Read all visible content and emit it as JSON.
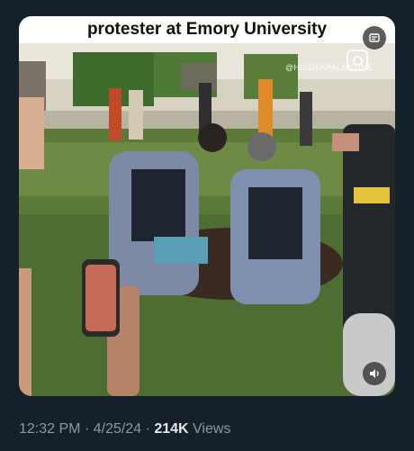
{
  "video": {
    "caption": "protester at Emory University",
    "watermark": "@HIDDENPALESTINE"
  },
  "icons": {
    "alt_overlay": "media-overlay-icon",
    "instagram": "instagram-icon",
    "mute": "speaker-icon"
  },
  "tweet_meta": {
    "time": "12:32 PM",
    "separator": "·",
    "date": "4/25/24",
    "views_count": "214K",
    "views_label": "Views"
  },
  "colors": {
    "background": "#15202b",
    "meta_text": "#8b98a5",
    "views_count": "#e7e9ea",
    "caption_bg": "#ffffff"
  }
}
